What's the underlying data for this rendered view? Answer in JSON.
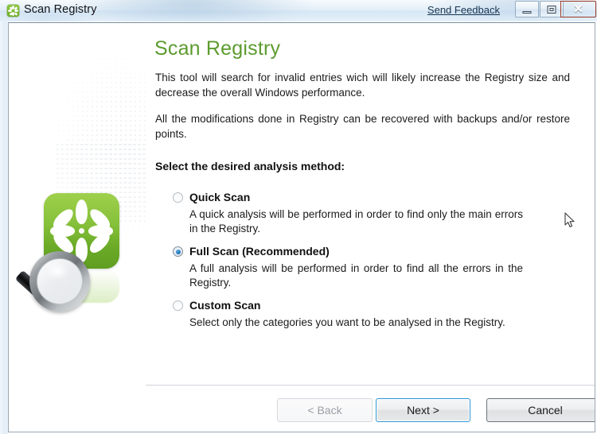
{
  "window": {
    "title": "Scan Registry",
    "app_icon": "green-flower-icon",
    "send_feedback_label": "Send Feedback",
    "controls": {
      "minimize": "minimize-button",
      "maximize": "maximize-button",
      "close_glyph": "✕"
    },
    "accent_green": "#5c9b2e",
    "logo_green": "#86c13b",
    "focus_blue": "#2e97d4"
  },
  "main": {
    "heading": "Scan Registry",
    "paragraph_1": "This tool will search for invalid entries wich will likely increase the Registry size and decrease the overall Windows performance.",
    "paragraph_2": "All the modifications done in Registry can be recovered with backups and/or restore points.",
    "section_label": "Select the desired analysis method:",
    "options": [
      {
        "label": "Quick Scan",
        "description": "A quick analysis will be performed in order to find only the main errors in the Registry.",
        "selected": false
      },
      {
        "label": "Full Scan (Recommended)",
        "description": "A full analysis will be performed in order to find all the errors in the Registry.",
        "selected": true
      },
      {
        "label": "Custom Scan",
        "description": "Select only the categories you want to be analysed in the Registry.",
        "selected": false
      }
    ]
  },
  "footer": {
    "back_label": "< Back",
    "next_label": "Next >",
    "cancel_label": "Cancel",
    "back_enabled": false,
    "next_focused": true
  }
}
